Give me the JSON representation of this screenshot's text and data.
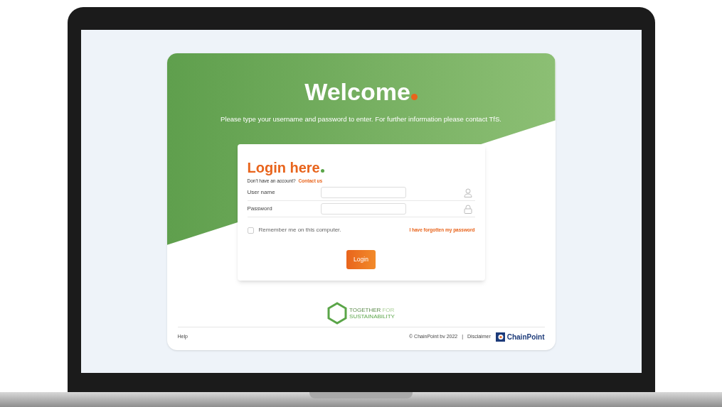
{
  "welcome": {
    "title": "Welcome",
    "subtitle": "Please type your username and password to enter. For further information please contact TfS."
  },
  "login": {
    "title": "Login here",
    "prompt": "Don't have an account?",
    "contact_link": "Contact us",
    "fields": [
      {
        "kind": "user",
        "label": "User name"
      },
      {
        "kind": "password",
        "label": "Password"
      }
    ],
    "remember": {
      "label": "Remember me on this computer.",
      "checked": false
    },
    "forgot_link": "I have forgotten my password",
    "button": "Login"
  },
  "partner_logo": {
    "word_1": "TOGETHER",
    "word_2": "FOR",
    "word_3": "SUSTAINABILITY"
  },
  "footer": {
    "help": "Help",
    "copyright": "© ChainPoint bv 2022",
    "separator": "|",
    "disclaimer": "Disclaimer",
    "brand": "ChainPoint"
  }
}
